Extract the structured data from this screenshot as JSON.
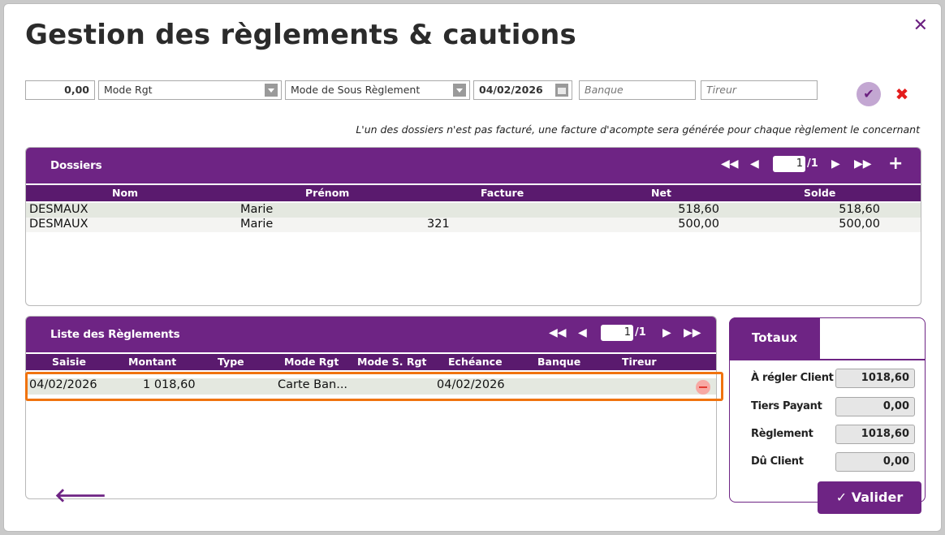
{
  "title": "Gestion des règlements & cautions",
  "toolbar": {
    "amount": "0,00",
    "mode_rgt": "Mode Rgt",
    "mode_sous_rgt": "Mode de Sous Règlement",
    "date": "04/02/2026",
    "banque_placeholder": "Banque",
    "tireur_placeholder": "Tireur"
  },
  "notice": "L'un des dossiers n'est pas facturé, une facture d'acompte sera générée pour chaque règlement le concernant",
  "dossiers": {
    "title": "Dossiers",
    "page": "1",
    "page_total": "/1",
    "columns": [
      "Nom",
      "Prénom",
      "Facture",
      "Net",
      "Solde"
    ],
    "rows": [
      {
        "nom": "DESMAUX",
        "prenom": "Marie",
        "facture": "",
        "net": "518,60",
        "solde": "518,60"
      },
      {
        "nom": "DESMAUX",
        "prenom": "Marie",
        "facture": "321",
        "net": "500,00",
        "solde": "500,00"
      }
    ]
  },
  "reglements": {
    "title": "Liste des Règlements",
    "page": "1",
    "page_total": "/1",
    "columns": [
      "Saisie",
      "Montant",
      "Type",
      "Mode Rgt",
      "Mode S. Rgt",
      "Echéance",
      "Banque",
      "Tireur"
    ],
    "rows": [
      {
        "saisie": "04/02/2026",
        "montant": "1 018,60",
        "type": "",
        "mode": "Carte Ban...",
        "mode_s": "",
        "echeance": "04/02/2026",
        "banque": "",
        "tireur": ""
      }
    ]
  },
  "totaux": {
    "title": "Totaux",
    "items": [
      {
        "label": "À régler Client",
        "value": "1018,60"
      },
      {
        "label": "Tiers Payant",
        "value": "0,00"
      },
      {
        "label": "Règlement",
        "value": "1018,60"
      },
      {
        "label": "Dû Client",
        "value": "0,00"
      }
    ]
  },
  "valider_label": "Valider",
  "icons": {
    "close": "close-icon",
    "confirm": "check-icon",
    "cancel": "x-icon",
    "back": "arrow-left-icon",
    "remove": "minus-circle-icon"
  },
  "colors": {
    "brand": "#6e2484",
    "highlight": "#f0730f",
    "danger": "#e41c1c"
  }
}
